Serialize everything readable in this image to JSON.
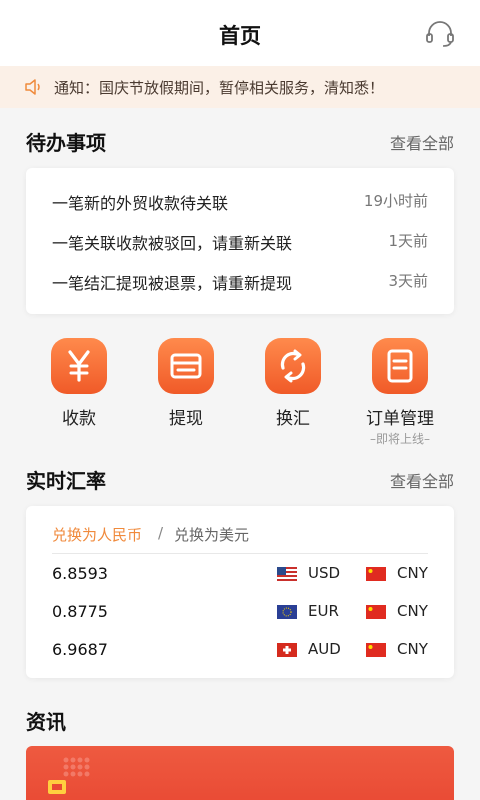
{
  "header": {
    "title": "首页",
    "support_icon": "headset-icon"
  },
  "notice": {
    "icon": "speaker-icon",
    "text": "通知：国庆节放假期间，暂停相关服务，清知悉！"
  },
  "todo": {
    "title": "待办事项",
    "more": "查看全部",
    "items": [
      {
        "text": "一笔新的外贸收款待关联",
        "time": "19小时前"
      },
      {
        "text": "一笔关联收款被驳回，请重新关联",
        "time": "1天前"
      },
      {
        "text": "一笔结汇提现被退票，请重新提现",
        "time": "3天前"
      }
    ]
  },
  "actions": [
    {
      "label": "收款",
      "icon": "yuan-icon",
      "sub": ""
    },
    {
      "label": "提现",
      "icon": "card-icon",
      "sub": ""
    },
    {
      "label": "换汇",
      "icon": "exchange-icon",
      "sub": ""
    },
    {
      "label": "订单管理",
      "icon": "order-icon",
      "sub": "–即将上线–"
    }
  ],
  "rates": {
    "title": "实时汇率",
    "more": "查看全部",
    "tab_active": "兑换为人民币",
    "separator": "/",
    "tab_inactive": "兑换为美元",
    "rows": [
      {
        "value": "6.8593",
        "from": "USD",
        "from_flag": "us-flag-icon",
        "to": "CNY",
        "to_flag": "cn-flag-icon"
      },
      {
        "value": "0.8775",
        "from": "EUR",
        "from_flag": "eu-flag-icon",
        "to": "CNY",
        "to_flag": "cn-flag-icon"
      },
      {
        "value": "6.9687",
        "from": "AUD",
        "from_flag": "ch-flag-icon",
        "to": "CNY",
        "to_flag": "cn-flag-icon"
      }
    ]
  },
  "news": {
    "title": "资讯"
  },
  "colors": {
    "accent": "#f05a28",
    "accent_text": "#f08a3c",
    "notice_bg": "#fbf0e7"
  }
}
